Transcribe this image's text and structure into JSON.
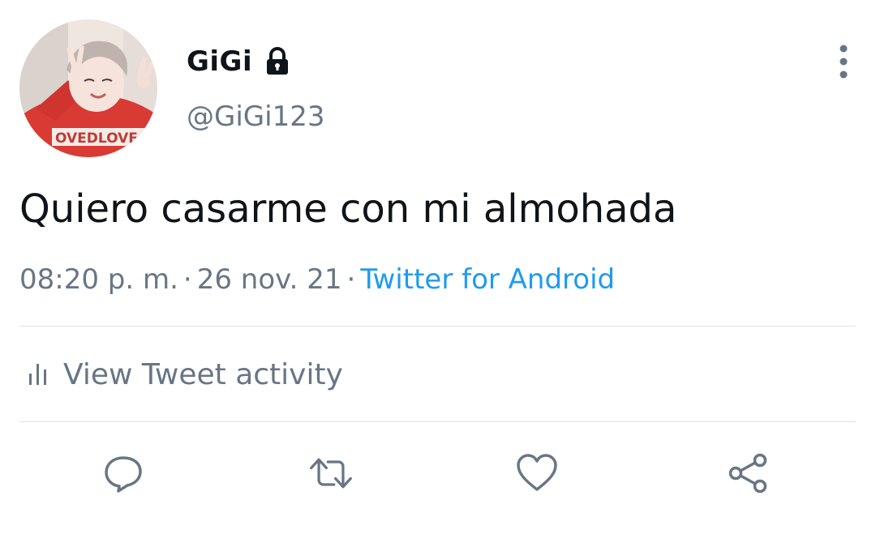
{
  "user": {
    "display_name": "GiGi",
    "handle": "@GiGi123",
    "avatar": "avatar-photo",
    "protected_icon": "lock-icon"
  },
  "tweet": {
    "text": "Quiero casarme con mi almohada",
    "time": "08:20 p. m.",
    "separator": "·",
    "date": "26 nov. 21",
    "source": "Twitter for Android"
  },
  "activity": {
    "label": "View Tweet activity",
    "icon": "bar-chart-icon"
  },
  "actions": [
    {
      "name": "reply",
      "icon": "reply-icon"
    },
    {
      "name": "retweet",
      "icon": "retweet-icon"
    },
    {
      "name": "like",
      "icon": "heart-icon"
    },
    {
      "name": "share",
      "icon": "share-icon"
    }
  ],
  "colors": {
    "text_primary": "#0f1419",
    "text_secondary": "#687684",
    "link": "#1d9bf0",
    "divider": "#dfe3e6"
  }
}
